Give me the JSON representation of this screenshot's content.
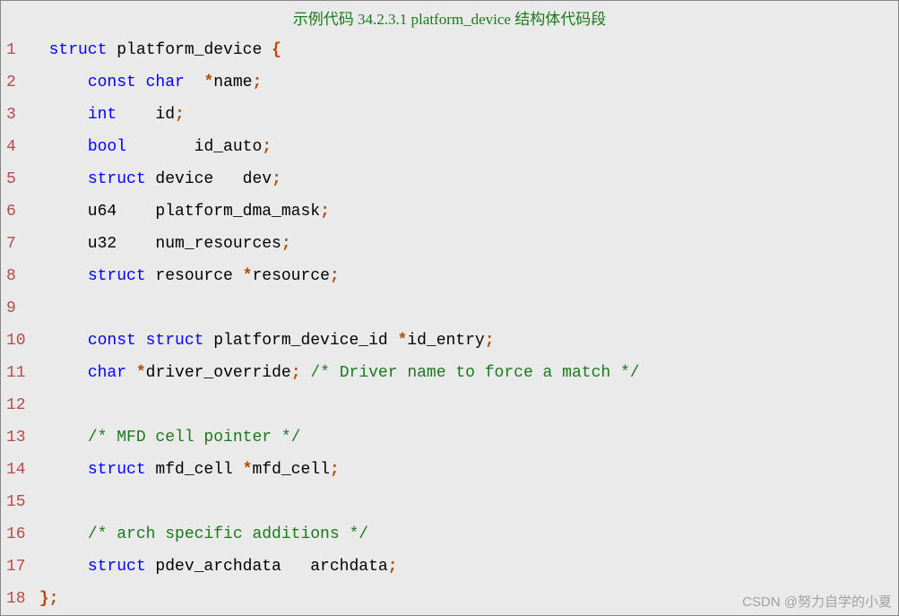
{
  "title": "示例代码 34.2.3.1 platform_device 结构体代码段",
  "watermark": "CSDN @努力自学的小夏",
  "lines": [
    {
      "num": "1",
      "tokens": [
        {
          "t": "kw",
          "v": "  struct"
        },
        {
          "t": "ident",
          "v": " platform_device "
        },
        {
          "t": "punct",
          "v": "{"
        }
      ]
    },
    {
      "num": "2",
      "tokens": [
        {
          "t": "ident",
          "v": "      "
        },
        {
          "t": "kw",
          "v": "const char"
        },
        {
          "t": "ident",
          "v": "  "
        },
        {
          "t": "punct",
          "v": "*"
        },
        {
          "t": "ident",
          "v": "name"
        },
        {
          "t": "punct",
          "v": ";"
        }
      ]
    },
    {
      "num": "3",
      "tokens": [
        {
          "t": "ident",
          "v": "      "
        },
        {
          "t": "kw",
          "v": "int"
        },
        {
          "t": "ident",
          "v": "    id"
        },
        {
          "t": "punct",
          "v": ";"
        }
      ]
    },
    {
      "num": "4",
      "tokens": [
        {
          "t": "ident",
          "v": "      "
        },
        {
          "t": "kw",
          "v": "bool"
        },
        {
          "t": "ident",
          "v": "       id_auto"
        },
        {
          "t": "punct",
          "v": ";"
        }
      ]
    },
    {
      "num": "5",
      "tokens": [
        {
          "t": "ident",
          "v": "      "
        },
        {
          "t": "kw",
          "v": "struct"
        },
        {
          "t": "ident",
          "v": " device   dev"
        },
        {
          "t": "punct",
          "v": ";"
        }
      ]
    },
    {
      "num": "6",
      "tokens": [
        {
          "t": "ident",
          "v": "      u64    platform_dma_mask"
        },
        {
          "t": "punct",
          "v": ";"
        }
      ]
    },
    {
      "num": "7",
      "tokens": [
        {
          "t": "ident",
          "v": "      u32    num_resources"
        },
        {
          "t": "punct",
          "v": ";"
        }
      ]
    },
    {
      "num": "8",
      "tokens": [
        {
          "t": "ident",
          "v": "      "
        },
        {
          "t": "kw",
          "v": "struct"
        },
        {
          "t": "ident",
          "v": " resource "
        },
        {
          "t": "punct",
          "v": "*"
        },
        {
          "t": "ident",
          "v": "resource"
        },
        {
          "t": "punct",
          "v": ";"
        }
      ]
    },
    {
      "num": "9",
      "tokens": []
    },
    {
      "num": "10",
      "tokens": [
        {
          "t": "ident",
          "v": "      "
        },
        {
          "t": "kw",
          "v": "const struct"
        },
        {
          "t": "ident",
          "v": " platform_device_id "
        },
        {
          "t": "punct",
          "v": "*"
        },
        {
          "t": "ident",
          "v": "id_entry"
        },
        {
          "t": "punct",
          "v": ";"
        }
      ]
    },
    {
      "num": "11",
      "tokens": [
        {
          "t": "ident",
          "v": "      "
        },
        {
          "t": "kw",
          "v": "char"
        },
        {
          "t": "ident",
          "v": " "
        },
        {
          "t": "punct",
          "v": "*"
        },
        {
          "t": "ident",
          "v": "driver_override"
        },
        {
          "t": "punct",
          "v": ";"
        },
        {
          "t": "ident",
          "v": " "
        },
        {
          "t": "comment",
          "v": "/* Driver name to force a match */"
        }
      ]
    },
    {
      "num": "12",
      "tokens": []
    },
    {
      "num": "13",
      "tokens": [
        {
          "t": "ident",
          "v": "      "
        },
        {
          "t": "comment",
          "v": "/* MFD cell pointer */"
        }
      ]
    },
    {
      "num": "14",
      "tokens": [
        {
          "t": "ident",
          "v": "      "
        },
        {
          "t": "kw",
          "v": "struct"
        },
        {
          "t": "ident",
          "v": " mfd_cell "
        },
        {
          "t": "punct",
          "v": "*"
        },
        {
          "t": "ident",
          "v": "mfd_cell"
        },
        {
          "t": "punct",
          "v": ";"
        }
      ]
    },
    {
      "num": "15",
      "tokens": []
    },
    {
      "num": "16",
      "tokens": [
        {
          "t": "ident",
          "v": "      "
        },
        {
          "t": "comment",
          "v": "/* arch specific additions */"
        }
      ]
    },
    {
      "num": "17",
      "tokens": [
        {
          "t": "ident",
          "v": "      "
        },
        {
          "t": "kw",
          "v": "struct"
        },
        {
          "t": "ident",
          "v": " pdev_archdata   archdata"
        },
        {
          "t": "punct",
          "v": ";"
        }
      ]
    },
    {
      "num": "18",
      "tokens": [
        {
          "t": "ident",
          "v": " "
        },
        {
          "t": "punct",
          "v": "};"
        }
      ]
    }
  ]
}
